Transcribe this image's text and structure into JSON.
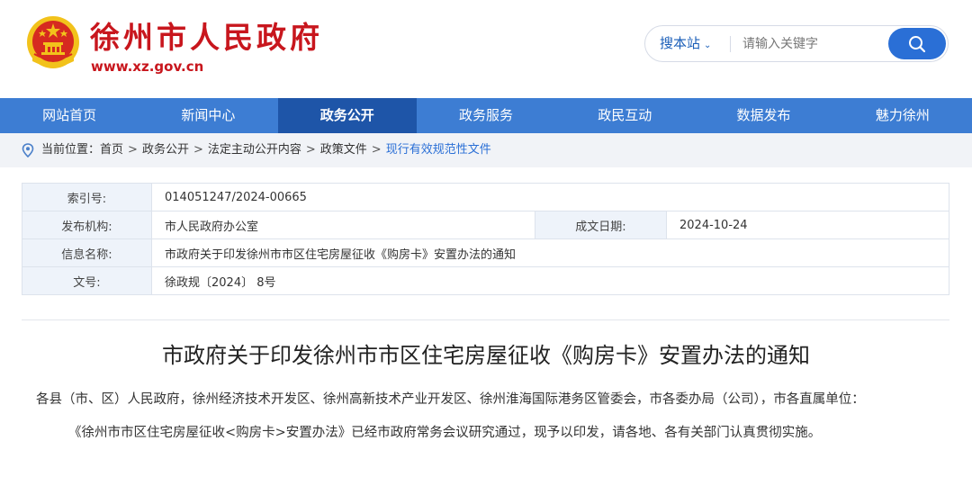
{
  "header": {
    "site_title": "徐州市人民政府",
    "site_url": "www.xz.gov.cn",
    "brand_color": "#c8161d"
  },
  "search": {
    "scope_label": "搜本站",
    "placeholder": "请输入关键字",
    "button_icon": "search-icon",
    "accent": "#2a6fd6"
  },
  "nav": {
    "items": [
      {
        "label": "网站首页"
      },
      {
        "label": "新闻中心"
      },
      {
        "label": "政务公开"
      },
      {
        "label": "政务服务"
      },
      {
        "label": "政民互动"
      },
      {
        "label": "数据发布"
      },
      {
        "label": "魅力徐州"
      }
    ],
    "active_index": 2,
    "bg": "#3d7dd3",
    "active_bg": "#1e55a8"
  },
  "breadcrumb": {
    "prefix": "当前位置：",
    "items": [
      "首页",
      "政务公开",
      "法定主动公开内容",
      "政策文件",
      "现行有效规范性文件"
    ],
    "separator": ">"
  },
  "info": {
    "index_label": "索引号:",
    "index_value": "014051247/2024-00665",
    "org_label": "发布机构:",
    "org_value": "市人民政府办公室",
    "date_label": "成文日期:",
    "date_value": "2024-10-24",
    "name_label": "信息名称:",
    "name_value": "市政府关于印发徐州市市区住宅房屋征收《购房卡》安置办法的通知",
    "docno_label": "文号:",
    "docno_value": "徐政规〔2024〕 8号"
  },
  "document": {
    "title": "市政府关于印发徐州市市区住宅房屋征收《购房卡》安置办法的通知",
    "para1": "各县（市、区）人民政府，徐州经济技术开发区、徐州高新技术产业开发区、徐州淮海国际港务区管委会，市各委办局（公司），市各直属单位：",
    "para2": "《徐州市市区住宅房屋征收<购房卡>安置办法》已经市政府常务会议研究通过，现予以印发，请各地、各有关部门认真贯彻实施。"
  }
}
